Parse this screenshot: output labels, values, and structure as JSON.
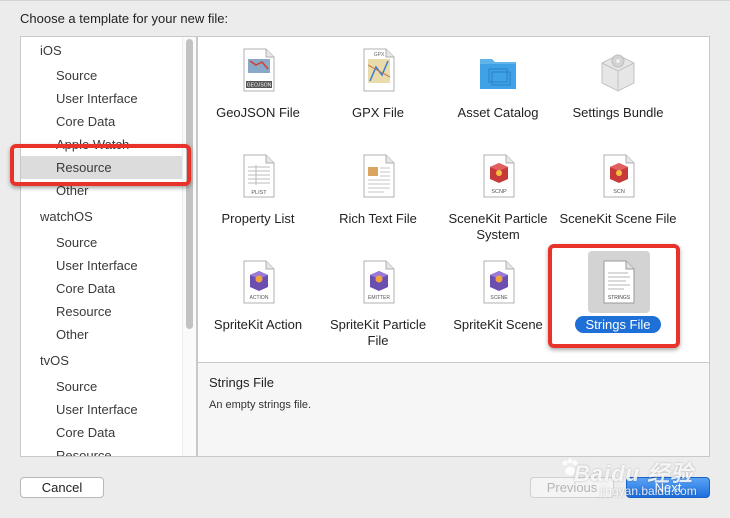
{
  "dialog": {
    "title": "Choose a template for your new file:"
  },
  "sidebar": {
    "rows": [
      {
        "label": "iOS",
        "kind": "platform"
      },
      {
        "label": "Source",
        "kind": "cat"
      },
      {
        "label": "User Interface",
        "kind": "cat"
      },
      {
        "label": "Core Data",
        "kind": "cat"
      },
      {
        "label": "Apple Watch",
        "kind": "cat"
      },
      {
        "label": "Resource",
        "kind": "cat",
        "selected": true
      },
      {
        "label": "Other",
        "kind": "cat"
      },
      {
        "label": "watchOS",
        "kind": "platform"
      },
      {
        "label": "Source",
        "kind": "cat"
      },
      {
        "label": "User Interface",
        "kind": "cat"
      },
      {
        "label": "Core Data",
        "kind": "cat"
      },
      {
        "label": "Resource",
        "kind": "cat"
      },
      {
        "label": "Other",
        "kind": "cat"
      },
      {
        "label": "tvOS",
        "kind": "platform"
      },
      {
        "label": "Source",
        "kind": "cat"
      },
      {
        "label": "User Interface",
        "kind": "cat"
      },
      {
        "label": "Core Data",
        "kind": "cat"
      },
      {
        "label": "Resource",
        "kind": "cat"
      }
    ]
  },
  "templates": [
    {
      "label": "GeoJSON File",
      "icon": "geojson-icon",
      "badge": "GEOJSON"
    },
    {
      "label": "GPX File",
      "icon": "gpx-icon",
      "badge": "GPX"
    },
    {
      "label": "Asset Catalog",
      "icon": "folder-icon"
    },
    {
      "label": "Settings Bundle",
      "icon": "settings-bundle-icon"
    },
    {
      "label": "Property List",
      "icon": "plist-icon",
      "badge": "PLIST"
    },
    {
      "label": "Rich Text File",
      "icon": "rich-text-icon"
    },
    {
      "label": "SceneKit Particle System",
      "icon": "scenekit-icon",
      "badge": "SCNP"
    },
    {
      "label": "SceneKit Scene File",
      "icon": "scenekit-icon",
      "badge": "SCN"
    },
    {
      "label": "SpriteKit Action",
      "icon": "spritekit-icon",
      "badge": "ACTION"
    },
    {
      "label": "SpriteKit Particle File",
      "icon": "spritekit-icon",
      "badge": "EMITTER"
    },
    {
      "label": "SpriteKit Scene",
      "icon": "spritekit-icon",
      "badge": "SCENE"
    },
    {
      "label": "Strings File",
      "icon": "strings-icon",
      "badge": "STRINGS",
      "selected": true
    }
  ],
  "description": {
    "title": "Strings File",
    "text": "An empty strings file."
  },
  "buttons": {
    "cancel": "Cancel",
    "previous": "Previous",
    "next": "Next"
  },
  "watermark": {
    "main": "Baidu 经验",
    "sub": "jingyan.baidu.com"
  },
  "colors": {
    "accent": "#1e6fd6",
    "highlight": "#e8322a"
  }
}
